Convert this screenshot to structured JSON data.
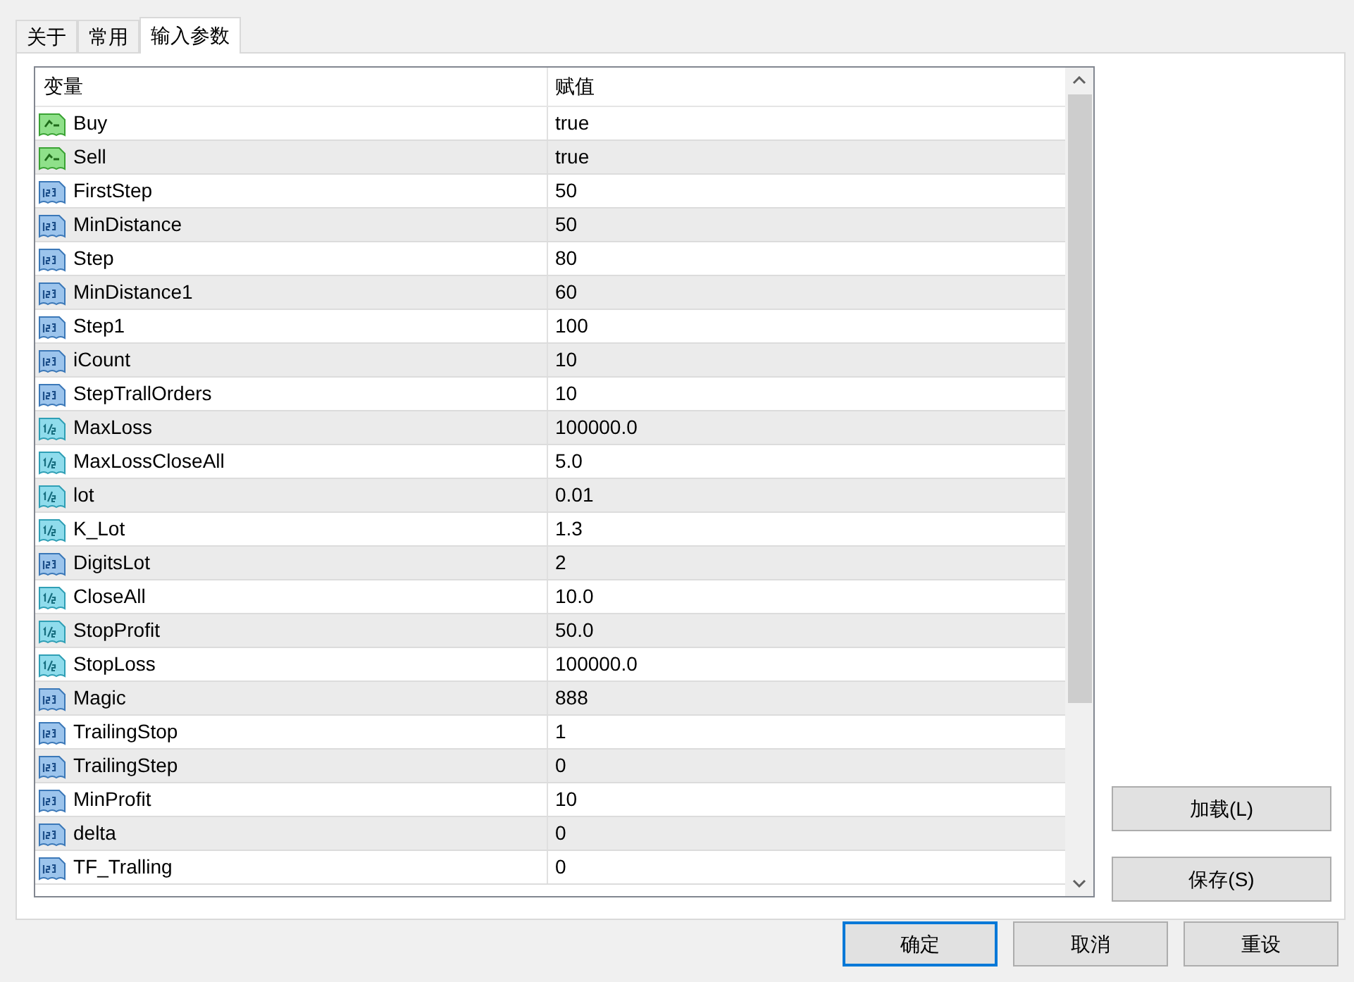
{
  "tabs": [
    {
      "label": "关于",
      "selected": false
    },
    {
      "label": "常用",
      "selected": false
    },
    {
      "label": "输入参数",
      "selected": true
    }
  ],
  "table": {
    "columns": [
      "变量",
      "赋值"
    ],
    "rows": [
      {
        "kind": "bool",
        "name": "Buy",
        "value": "true"
      },
      {
        "kind": "bool",
        "name": "Sell",
        "value": "true"
      },
      {
        "kind": "int",
        "name": "FirstStep",
        "value": "50"
      },
      {
        "kind": "int",
        "name": "MinDistance",
        "value": "50"
      },
      {
        "kind": "int",
        "name": "Step",
        "value": "80"
      },
      {
        "kind": "int",
        "name": "MinDistance1",
        "value": "60"
      },
      {
        "kind": "int",
        "name": "Step1",
        "value": "100"
      },
      {
        "kind": "int",
        "name": "iCount",
        "value": "10"
      },
      {
        "kind": "int",
        "name": "StepTrallOrders",
        "value": "10"
      },
      {
        "kind": "double",
        "name": "MaxLoss",
        "value": "100000.0"
      },
      {
        "kind": "double",
        "name": "MaxLossCloseAll",
        "value": "5.0"
      },
      {
        "kind": "double",
        "name": "lot",
        "value": "0.01"
      },
      {
        "kind": "double",
        "name": "K_Lot",
        "value": "1.3"
      },
      {
        "kind": "int",
        "name": "DigitsLot",
        "value": "2"
      },
      {
        "kind": "double",
        "name": "CloseAll",
        "value": "10.0"
      },
      {
        "kind": "double",
        "name": "StopProfit",
        "value": "50.0"
      },
      {
        "kind": "double",
        "name": "StopLoss",
        "value": "100000.0"
      },
      {
        "kind": "int",
        "name": "Magic",
        "value": "888"
      },
      {
        "kind": "int",
        "name": "TrailingStop",
        "value": "1"
      },
      {
        "kind": "int",
        "name": "TrailingStep",
        "value": "0"
      },
      {
        "kind": "int",
        "name": "MinProfit",
        "value": "10"
      },
      {
        "kind": "int",
        "name": "delta",
        "value": "0"
      },
      {
        "kind": "int",
        "name": "TF_Tralling",
        "value": "0"
      }
    ]
  },
  "side_buttons": [
    "加载(L)",
    "保存(S)"
  ],
  "buttons": [
    {
      "label": "确定",
      "default": true
    },
    {
      "label": "取消",
      "default": false
    },
    {
      "label": "重设",
      "default": false
    }
  ]
}
